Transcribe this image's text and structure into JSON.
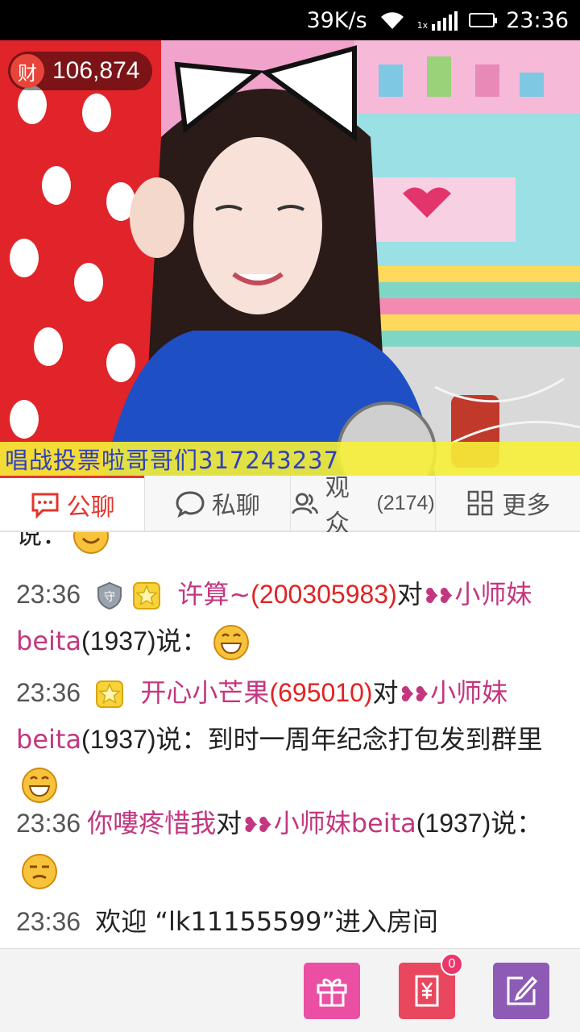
{
  "status_bar": {
    "speed": "39K/s",
    "time": "23:36"
  },
  "video": {
    "wealth_icon": "财",
    "wealth_value": "106,874",
    "marquee": "唱战投票啦哥哥们317243237"
  },
  "tabs": [
    {
      "label": "公聊",
      "icon": "chat-bubble-icon",
      "active": true
    },
    {
      "label": "私聊",
      "icon": "private-chat-icon",
      "has_dot": true
    },
    {
      "label": "观众",
      "count": "(2174)",
      "icon": "audience-icon"
    },
    {
      "label": "更多",
      "icon": "grid-icon"
    }
  ],
  "chat": {
    "partial_top": "说：",
    "messages": [
      {
        "time": "23:36",
        "user": "许算~",
        "uid": "(200305983)",
        "to_word": "对",
        "target": "小师妹beita",
        "target_num": "(1937)",
        "say": "说：",
        "text": ""
      },
      {
        "time": "23:36",
        "user": "开心小芒果",
        "uid": "(695010)",
        "to_word": "对",
        "target": "小师妹beita",
        "target_num": "(1937)",
        "say": "说：",
        "text": "到时一周年纪念打包发到群里"
      },
      {
        "time": "23:36",
        "user": "你嘍疼惜我",
        "to_word": "对",
        "target": "小师妹beita",
        "target_num": "(1937)",
        "say": "说："
      },
      {
        "time": "23:36",
        "text": "欢迎 “lk11155599”进入房间"
      }
    ]
  },
  "bottom_bar": {
    "pay_badge": "0"
  },
  "colors": {
    "accent": "#e4352d",
    "username": "#c2377f",
    "uid": "#e02323"
  }
}
